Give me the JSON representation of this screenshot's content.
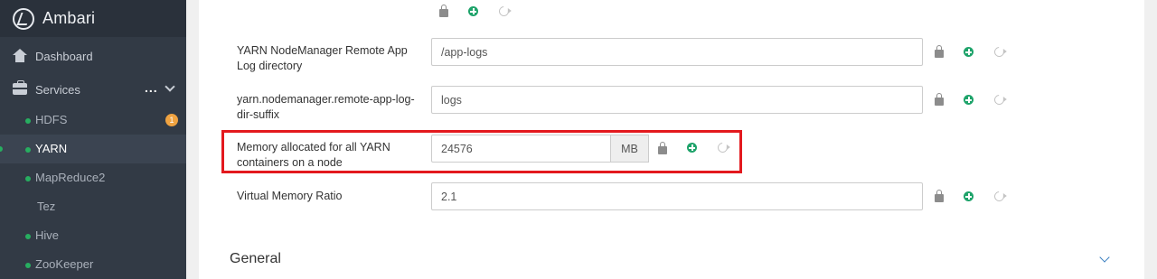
{
  "app": {
    "title": "Ambari"
  },
  "sidebar": {
    "dashboard_label": "Dashboard",
    "services_label": "Services",
    "services_more": "...",
    "services": [
      {
        "label": "HDFS",
        "status": "green",
        "badge": "1"
      },
      {
        "label": "YARN",
        "status": "green",
        "active": true
      },
      {
        "label": "MapReduce2",
        "status": "green"
      },
      {
        "label": "Tez",
        "status": "none"
      },
      {
        "label": "Hive",
        "status": "green"
      },
      {
        "label": "ZooKeeper",
        "status": "green"
      }
    ]
  },
  "config": {
    "rows": [
      {
        "label": "YARN NodeManager Remote App Log directory",
        "value": "/app-logs"
      },
      {
        "label": "yarn.nodemanager.remote-app-log-dir-suffix",
        "value": "logs"
      },
      {
        "label": "Memory allocated for all YARN containers on a node",
        "value": "24576",
        "unit": "MB"
      },
      {
        "label": "Virtual Memory Ratio",
        "value": "2.1"
      }
    ],
    "section_title": "General"
  },
  "colors": {
    "sidebar_bg": "#323a45",
    "status_green": "#27ae60",
    "badge_orange": "#f0a341",
    "highlight_red": "#e3191e",
    "add_green": "#1ea36a",
    "link_blue": "#3a7fc0"
  },
  "icons": {
    "logo": "ambari-logo-icon",
    "dashboard": "home-icon",
    "services": "briefcase-icon",
    "lock": "lock-icon",
    "add": "plus-circle-icon",
    "undo": "undo-icon",
    "expand": "chevron-down-icon"
  }
}
